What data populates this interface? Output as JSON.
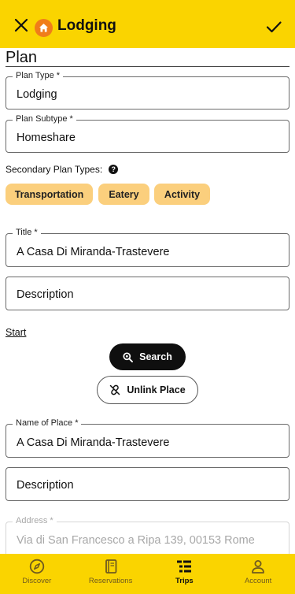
{
  "header": {
    "title": "Lodging",
    "close_icon": "close-icon",
    "home_icon": "home-icon",
    "save_icon": "check-icon",
    "home_icon_color": "#f07d1a",
    "bar_color": "#fad400"
  },
  "section": {
    "title": "Plan"
  },
  "plan_type": {
    "label": "Plan Type *",
    "value": "Lodging"
  },
  "plan_subtype": {
    "label": "Plan Subtype *",
    "value": "Homeshare"
  },
  "secondary": {
    "label": "Secondary Plan Types:",
    "help_icon": "help-icon",
    "chips": [
      "Transportation",
      "Eatery",
      "Activity"
    ],
    "chip_color": "#fbcf7d"
  },
  "title_field": {
    "label": "Title *",
    "value": "A Casa Di Miranda-Trastevere"
  },
  "description1": {
    "placeholder": "Description"
  },
  "start": {
    "label": "Start"
  },
  "search_button": {
    "label": "Search",
    "icon": "search-icon"
  },
  "unlink_button": {
    "label": "Unlink Place",
    "icon": "unlink-icon"
  },
  "place_name": {
    "label": "Name of Place *",
    "value": "A Casa Di Miranda-Trastevere"
  },
  "description2": {
    "placeholder": "Description"
  },
  "address": {
    "label": "Address *",
    "value": "Via di San Francesco a Ripa 139, 00153 Rome"
  },
  "bottom_nav": {
    "items": [
      {
        "label": "Discover",
        "icon": "compass-icon",
        "active": false
      },
      {
        "label": "Reservations",
        "icon": "book-icon",
        "active": false
      },
      {
        "label": "Trips",
        "icon": "list-icon",
        "active": true
      },
      {
        "label": "Account",
        "icon": "person-icon",
        "active": false
      }
    ]
  }
}
